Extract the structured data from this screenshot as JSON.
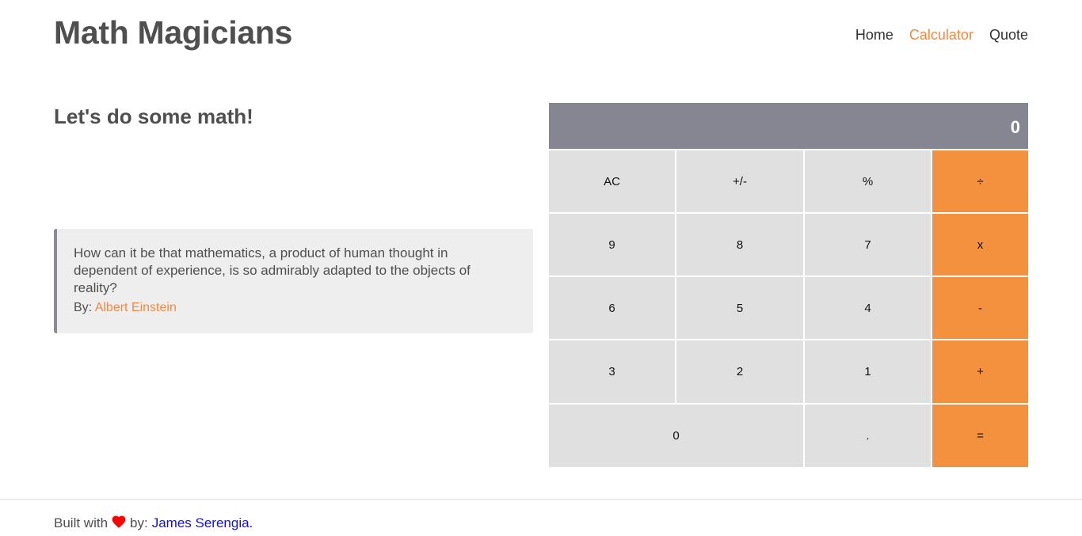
{
  "header": {
    "logo": "Math Magicians",
    "nav": [
      {
        "label": "Home",
        "active": false
      },
      {
        "label": "Calculator",
        "active": true
      },
      {
        "label": "Quote",
        "active": false
      }
    ]
  },
  "main": {
    "heading": "Let's do some math!",
    "quote": {
      "text": "How can it be that mathematics, a product of human thought in dependent of experience, is so admirably adapted to the objects of reality?",
      "by_label": "By:",
      "author": "Albert Einstein"
    }
  },
  "calculator": {
    "display": "0",
    "keys": [
      "AC",
      "+/-",
      "%",
      "÷",
      "9",
      "8",
      "7",
      "x",
      "6",
      "5",
      "4",
      "-",
      "3",
      "2",
      "1",
      "+",
      "0",
      ".",
      "="
    ]
  },
  "footer": {
    "prefix": "Built with",
    "icon": "heart-icon",
    "middle": "by:",
    "author": "James Serengia."
  },
  "colors": {
    "accent": "#f4913e",
    "display_bg": "#858692",
    "key_bg": "#e0e0e0",
    "link": "#1010e0",
    "heart": "#ff0000"
  }
}
